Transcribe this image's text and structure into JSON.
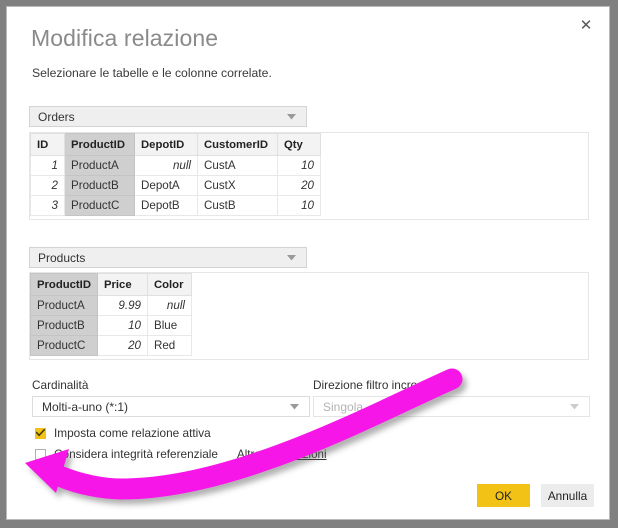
{
  "dialog": {
    "title": "Modifica relazione",
    "subtitle": "Selezionare le tabelle e le colonne correlate.",
    "close_label": "✕"
  },
  "table1": {
    "select_value": "Orders",
    "selected_column": "ProductID",
    "columns": [
      "ID",
      "ProductID",
      "DepotID",
      "CustomerID",
      "Qty"
    ],
    "rows": [
      [
        "1",
        "ProductA",
        "null",
        "CustA",
        "10"
      ],
      [
        "2",
        "ProductB",
        "DepotA",
        "CustX",
        "20"
      ],
      [
        "3",
        "ProductC",
        "DepotB",
        "CustB",
        "10"
      ]
    ]
  },
  "table2": {
    "select_value": "Products",
    "selected_column": "ProductID",
    "columns": [
      "ProductID",
      "Price",
      "Color"
    ],
    "rows": [
      [
        "ProductA",
        "9.99",
        "null"
      ],
      [
        "ProductB",
        "10",
        "Blue"
      ],
      [
        "ProductC",
        "20",
        "Red"
      ]
    ]
  },
  "options": {
    "cardinality_label": "Cardinalità",
    "cardinality_value": "Molti-a-uno (*:1)",
    "cross_filter_label": "Direzione filtro incrociato",
    "cross_filter_value": "Singola",
    "active_relation_label": "Imposta come relazione attiva",
    "active_relation_checked": true,
    "referential_integrity_label": "Considera integrità referenziale",
    "referential_integrity_checked": false,
    "more_info_link": "Altre informazioni"
  },
  "footer": {
    "ok_label": "OK",
    "cancel_label": "Annulla"
  },
  "annotation": {
    "color": "#F619E8",
    "description": "curved-arrow-pointing-to-referential-integrity-checkbox"
  }
}
